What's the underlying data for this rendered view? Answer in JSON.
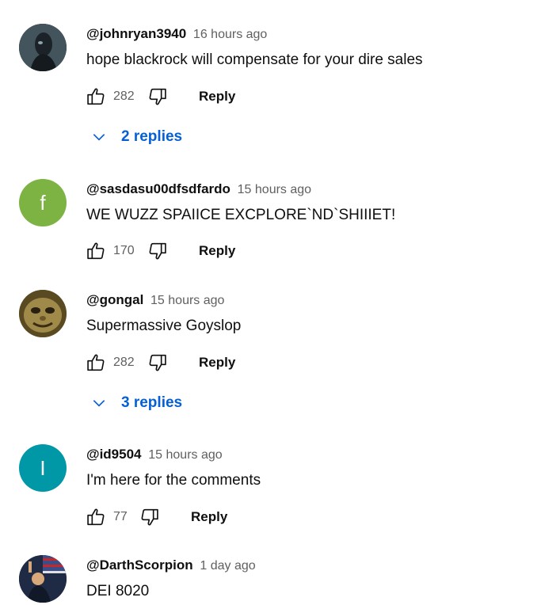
{
  "comments": [
    {
      "author": "@johnryan3940",
      "time": "16 hours ago",
      "text": "hope blackrock will compensate for your dire sales",
      "likes": "282",
      "reply_label": "Reply",
      "replies_label": "2 replies",
      "avatar": {
        "kind": "photo",
        "name": "dark-figure-avatar",
        "color": "#3b4a52"
      }
    },
    {
      "author": "@sasdasu00dfsdfardo",
      "time": "15 hours ago",
      "text": "WE WUZZ SPAIICE EXCPLORE`ND`SHIIIET!",
      "likes": "170",
      "reply_label": "Reply",
      "avatar": {
        "kind": "letter",
        "letter": "f",
        "color": "#7cb342"
      }
    },
    {
      "author": "@gongal",
      "time": "15 hours ago",
      "text": "Supermassive Goyslop",
      "likes": "282",
      "reply_label": "Reply",
      "replies_label": "3 replies",
      "avatar": {
        "kind": "photo",
        "name": "creature-avatar",
        "color": "#8a7a3e"
      }
    },
    {
      "author": "@id9504",
      "time": "15 hours ago",
      "text": "I'm here for the comments",
      "likes": "77",
      "reply_label": "Reply",
      "avatar": {
        "kind": "letter",
        "letter": "I",
        "color": "#0097a7"
      }
    },
    {
      "author": "@DarthScorpion",
      "time": "1 day ago",
      "text": "DEI 8020",
      "avatar": {
        "kind": "photo",
        "name": "flag-photo-avatar",
        "color": "#2a3550"
      }
    }
  ],
  "icons": {
    "like": "thumb-up-icon",
    "dislike": "thumb-down-icon",
    "expand": "chevron-down-icon"
  },
  "colors": {
    "link_blue": "#065fd4",
    "secondary_text": "#606060",
    "primary_text": "#0f0f0f"
  }
}
